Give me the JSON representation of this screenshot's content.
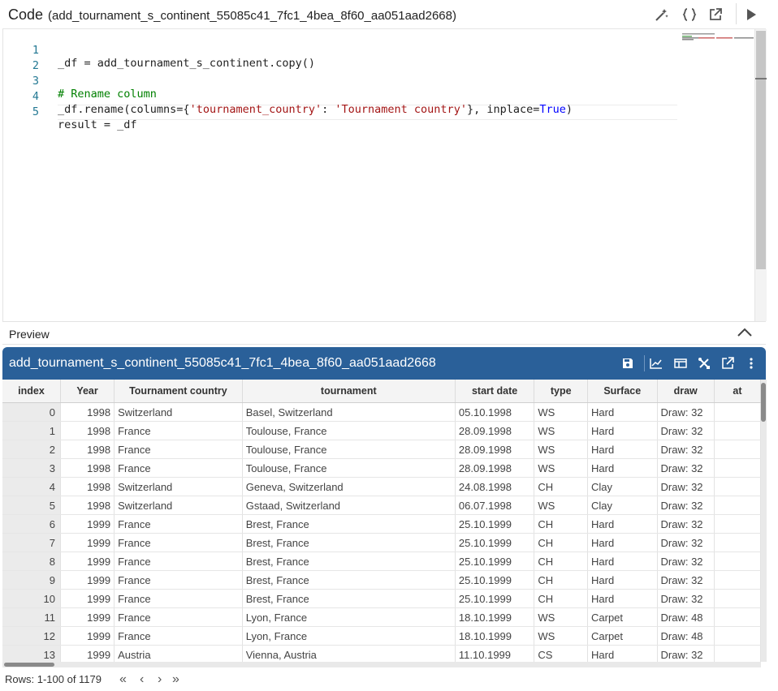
{
  "editor": {
    "title": "Code",
    "subtitle": "(add_tournament_s_continent_55085c41_7fc1_4bea_8f60_aa051aad2668)",
    "line_numbers": [
      "1",
      "2",
      "3",
      "4",
      "5"
    ],
    "lines": {
      "l1": "_df = add_tournament_s_continent.copy()",
      "l3": "# Rename column",
      "l4_a": "_df.rename(columns={",
      "l4_b": "'tournament_country'",
      "l4_c": ": ",
      "l4_d": "'Tournament country'",
      "l4_e": "}, inplace=",
      "l4_f": "True",
      "l4_g": ")",
      "l5": "result = _df"
    }
  },
  "preview": {
    "label": "Preview"
  },
  "dataframe": {
    "name": "add_tournament_s_continent_55085c41_7fc1_4bea_8f60_aa051aad2668",
    "columns": [
      "index",
      "Year",
      "Tournament country",
      "tournament",
      "start date",
      "type",
      "Surface",
      "draw",
      "at"
    ],
    "rows": [
      [
        "0",
        "1998",
        "Switzerland",
        "Basel, Switzerland",
        "05.10.1998",
        "WS",
        "Hard",
        "Draw: 32",
        ""
      ],
      [
        "1",
        "1998",
        "France",
        "Toulouse, France",
        "28.09.1998",
        "WS",
        "Hard",
        "Draw: 32",
        ""
      ],
      [
        "2",
        "1998",
        "France",
        "Toulouse, France",
        "28.09.1998",
        "WS",
        "Hard",
        "Draw: 32",
        ""
      ],
      [
        "3",
        "1998",
        "France",
        "Toulouse, France",
        "28.09.1998",
        "WS",
        "Hard",
        "Draw: 32",
        ""
      ],
      [
        "4",
        "1998",
        "Switzerland",
        "Geneva, Switzerland",
        "24.08.1998",
        "CH",
        "Clay",
        "Draw: 32",
        ""
      ],
      [
        "5",
        "1998",
        "Switzerland",
        "Gstaad, Switzerland",
        "06.07.1998",
        "WS",
        "Clay",
        "Draw: 32",
        ""
      ],
      [
        "6",
        "1999",
        "France",
        "Brest, France",
        "25.10.1999",
        "CH",
        "Hard",
        "Draw: 32",
        ""
      ],
      [
        "7",
        "1999",
        "France",
        "Brest, France",
        "25.10.1999",
        "CH",
        "Hard",
        "Draw: 32",
        ""
      ],
      [
        "8",
        "1999",
        "France",
        "Brest, France",
        "25.10.1999",
        "CH",
        "Hard",
        "Draw: 32",
        ""
      ],
      [
        "9",
        "1999",
        "France",
        "Brest, France",
        "25.10.1999",
        "CH",
        "Hard",
        "Draw: 32",
        ""
      ],
      [
        "10",
        "1999",
        "France",
        "Brest, France",
        "25.10.1999",
        "CH",
        "Hard",
        "Draw: 32",
        ""
      ],
      [
        "11",
        "1999",
        "France",
        "Lyon, France",
        "18.10.1999",
        "WS",
        "Carpet",
        "Draw: 48",
        ""
      ],
      [
        "12",
        "1999",
        "France",
        "Lyon, France",
        "18.10.1999",
        "WS",
        "Carpet",
        "Draw: 48",
        ""
      ],
      [
        "13",
        "1999",
        "Austria",
        "Vienna, Austria",
        "11.10.1999",
        "CS",
        "Hard",
        "Draw: 32",
        ""
      ]
    ],
    "footer": "Rows: 1-100 of 1179",
    "pager": {
      "first": "«",
      "prev": "‹",
      "next": "›",
      "last": "»"
    }
  },
  "colors": {
    "header_bg": "#2a6099",
    "line_number": "#237893",
    "comment": "#008000",
    "string": "#a31515",
    "keyword": "#0000ff"
  }
}
